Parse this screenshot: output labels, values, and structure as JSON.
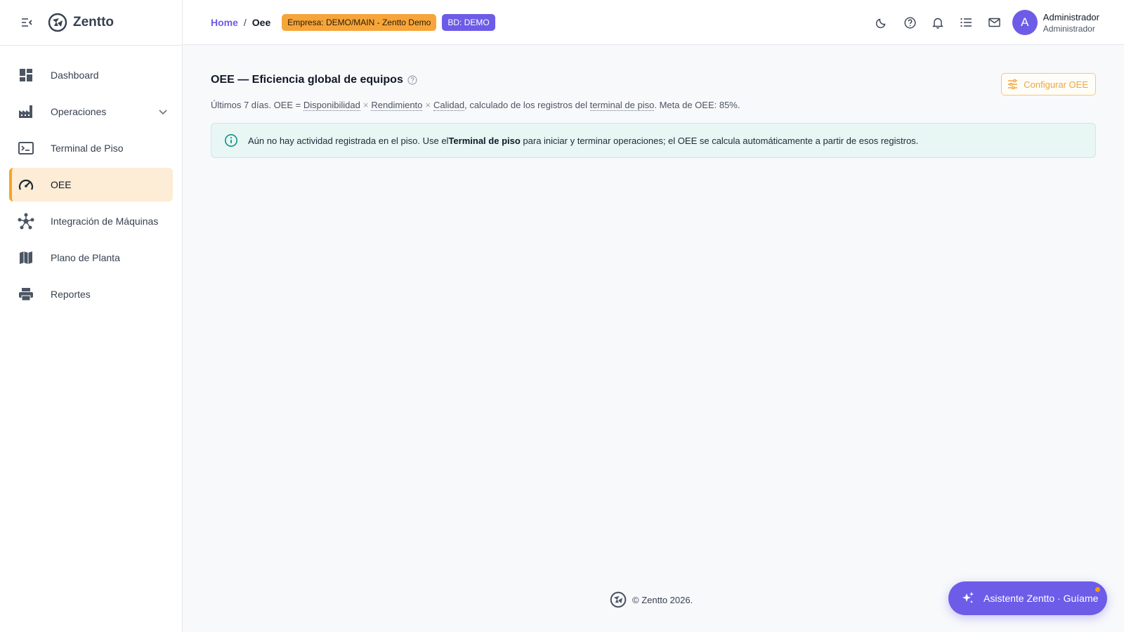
{
  "brand": {
    "name": "Zentto"
  },
  "sidebar": {
    "items": [
      {
        "label": "Dashboard",
        "icon": "dashboard-icon"
      },
      {
        "label": "Operaciones",
        "icon": "factory-icon"
      },
      {
        "label": "Terminal de Piso",
        "icon": "terminal-icon"
      },
      {
        "label": "OEE",
        "icon": "speedometer-icon",
        "active": true
      },
      {
        "label": "Integración de Máquinas",
        "icon": "hub-icon"
      },
      {
        "label": "Plano de Planta",
        "icon": "map-icon"
      },
      {
        "label": "Reportes",
        "icon": "printer-icon"
      }
    ]
  },
  "topbar": {
    "breadcrumb": {
      "home": "Home",
      "separator": "/",
      "current": "Oee"
    },
    "badges": {
      "empresa": "Empresa: DEMO/MAIN - Zentto Demo",
      "bd": "BD: DEMO"
    },
    "icons": [
      "moon-icon",
      "help-icon",
      "bell-icon",
      "list-icon",
      "mail-icon"
    ],
    "user": {
      "initial": "A",
      "name": "Administrador",
      "role": "Administrador"
    }
  },
  "page": {
    "title": "OEE — Eficiencia global de equipos",
    "config_button": "Configurar OEE",
    "subtitle": {
      "prefix": "Últimos 7 días. OEE = ",
      "term1": "Disponibilidad",
      "times": "×",
      "term2": "Rendimiento",
      "term3": "Calidad",
      "middle": ", calculado de los registros del ",
      "term4": "terminal de piso",
      "suffix": ". Meta de OEE: 85%."
    },
    "alert": {
      "before": "Aún no hay actividad registrada en el piso. Use el ",
      "strong": "Terminal de piso",
      "after": " para iniciar y terminar operaciones; el OEE se calcula automáticamente a partir de esos registros."
    }
  },
  "footer": {
    "text": "© Zentto 2026."
  },
  "assistant": {
    "label": "Asistente Zentto · Guíame"
  },
  "colors": {
    "accent": "#6d5ce8",
    "orange": "#f6a53a",
    "active_bg": "#fdecd6",
    "info": "#0f9488"
  }
}
